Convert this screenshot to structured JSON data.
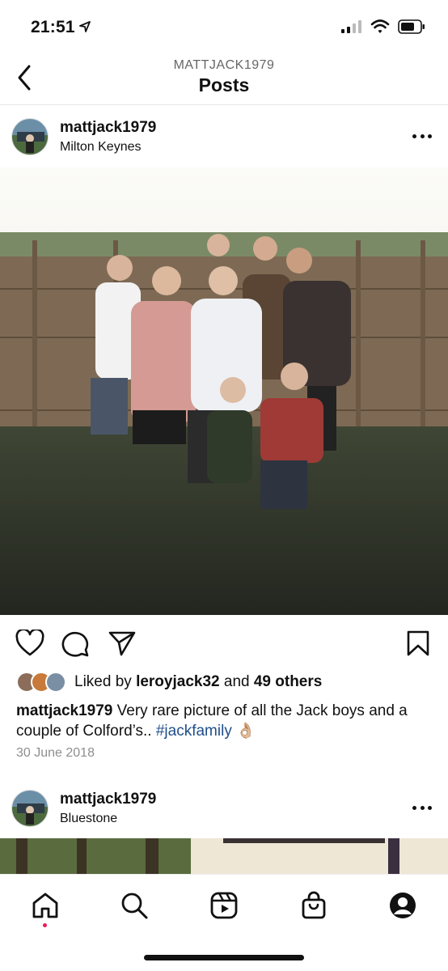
{
  "status_bar": {
    "time": "21:51",
    "icons": [
      "location-arrow-icon",
      "signal-icon",
      "wifi-icon",
      "battery-icon"
    ]
  },
  "header": {
    "username": "MATTJACK1979",
    "title": "Posts",
    "back_icon": "chevron-left-icon"
  },
  "post1": {
    "username": "mattjack1979",
    "location": "Milton Keynes",
    "image_alt": "photo",
    "actions": [
      "heart-icon",
      "comment-icon",
      "share-icon",
      "bookmark-icon"
    ],
    "liked_by_prefix": "Liked by",
    "liked_by_user": "leroyjack32",
    "liked_by_and": "and",
    "liked_by_others": "49 others",
    "caption_user": "mattjack1979",
    "caption_text": "Very rare picture of all the Jack boys and a couple of Colford’s..",
    "caption_hashtag": "#jackfamily",
    "caption_emoji": "👌🏼",
    "date": "30 June 2018"
  },
  "post2": {
    "username": "mattjack1979",
    "location": "Bluestone"
  },
  "tab_bar": {
    "tabs": [
      "home-icon",
      "search-icon",
      "reels-icon",
      "shop-icon",
      "profile-icon"
    ],
    "active": "home",
    "accent_color": "#ed1a5a"
  }
}
